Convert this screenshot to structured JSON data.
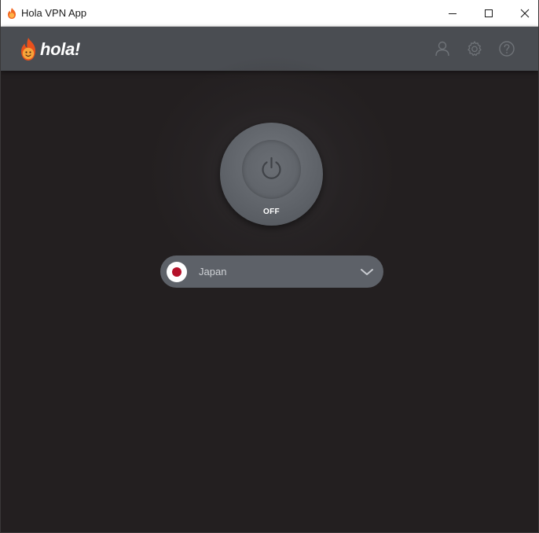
{
  "window": {
    "title": "Hola VPN App",
    "controls": {
      "minimize": "minimize-icon",
      "maximize": "maximize-icon",
      "close": "close-icon"
    }
  },
  "header": {
    "brand": "hola!",
    "icons": [
      "user-icon",
      "gear-icon",
      "help-icon"
    ]
  },
  "power": {
    "status": "OFF",
    "icon": "power-icon"
  },
  "location": {
    "country": "Japan",
    "flag": "japan-flag-icon",
    "dropdown_icon": "chevron-down-icon"
  },
  "colors": {
    "background": "#231f20",
    "header": "#4a4d52",
    "button": "#5e6268",
    "select": "#5d6168",
    "brand_orange": "#f26722",
    "flag_red": "#b5122a"
  }
}
